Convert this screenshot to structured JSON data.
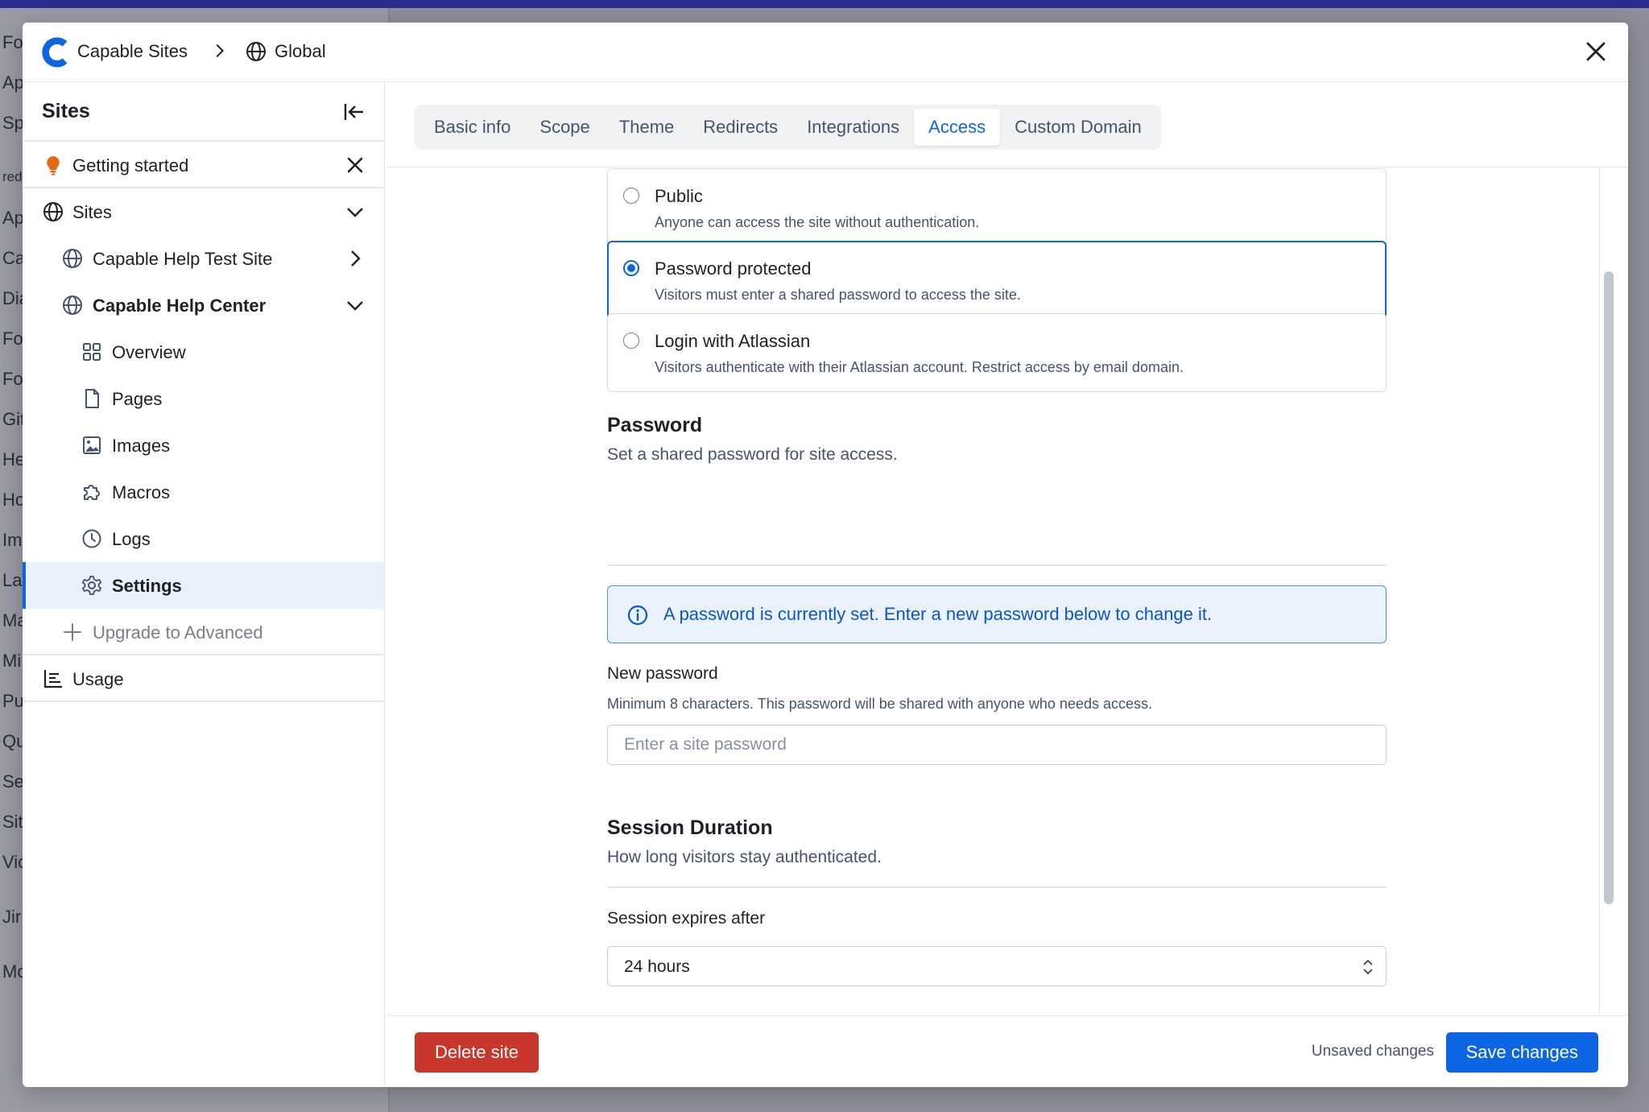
{
  "background": {
    "items": [
      "Fo",
      "Ap",
      "Sp",
      "red",
      "Ap",
      "Ca",
      "Dia",
      "Fo",
      "Fo",
      "Git",
      "He",
      "Ho",
      "Im",
      "La",
      "Ma",
      "Mi",
      "Pu",
      "Qu",
      "Se",
      "Sit",
      "Vic",
      "Jir",
      "Mo"
    ]
  },
  "header": {
    "brand": "Capable Sites",
    "breadcrumb_current": "Global",
    "icons": {
      "logo": "capable-logo",
      "separator": "chevron-right-icon",
      "globe": "globe-icon",
      "close": "close-icon"
    }
  },
  "sidebar": {
    "title": "Sites",
    "getting_started": "Getting started",
    "sites": "Sites",
    "site_test": "Capable Help Test Site",
    "site_center": "Capable Help Center",
    "overview": "Overview",
    "pages": "Pages",
    "images": "Images",
    "macros": "Macros",
    "logs": "Logs",
    "settings": "Settings",
    "upgrade": "Upgrade to Advanced",
    "usage": "Usage"
  },
  "tabs": [
    {
      "label": "Basic info",
      "active": false
    },
    {
      "label": "Scope",
      "active": false
    },
    {
      "label": "Theme",
      "active": false
    },
    {
      "label": "Redirects",
      "active": false
    },
    {
      "label": "Integrations",
      "active": false
    },
    {
      "label": "Access",
      "active": true
    },
    {
      "label": "Custom Domain",
      "active": false
    }
  ],
  "access": {
    "options": [
      {
        "title": "Public",
        "desc": "Anyone can access the site without authentication.",
        "selected": false
      },
      {
        "title": "Password protected",
        "desc": "Visitors must enter a shared password to access the site.",
        "selected": true
      },
      {
        "title": "Login with Atlassian",
        "desc": "Visitors authenticate with their Atlassian account. Restrict access by email domain.",
        "selected": false
      }
    ]
  },
  "password": {
    "title": "Password",
    "subtitle": "Set a shared password for site access.",
    "info": "A password is currently set. Enter a new password below to change it.",
    "field_label": "New password",
    "field_help": "Minimum 8 characters. This password will be shared with anyone who needs access.",
    "value": "",
    "placeholder": "Enter a site password"
  },
  "session": {
    "title": "Session Duration",
    "subtitle": "How long visitors stay authenticated.",
    "field_label": "Session expires after",
    "value": "24 hours"
  },
  "footer": {
    "delete_label": "Delete site",
    "status": "Unsaved changes",
    "save_label": "Save changes"
  },
  "colors": {
    "primary": "#0c66e4",
    "danger": "#c9372c",
    "active_bg": "#e9f1fc",
    "info_bg": "#e9f2fd",
    "bulb": "#e56910"
  }
}
